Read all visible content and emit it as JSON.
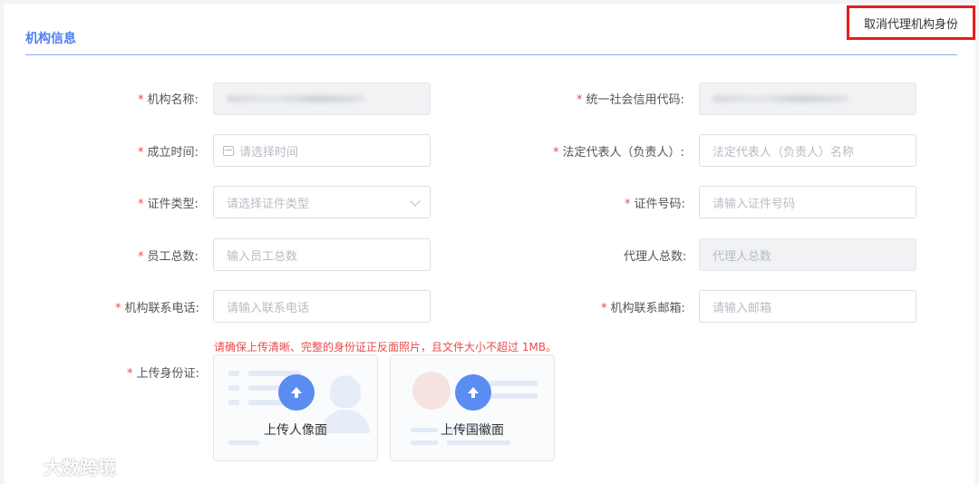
{
  "section": {
    "title": "机构信息"
  },
  "cancel_proxy_label": "取消代理机构身份",
  "fields": {
    "org_name": {
      "label": "机构名称:",
      "required": true
    },
    "credit_code": {
      "label": "统一社会信用代码:",
      "required": true
    },
    "founded": {
      "label": "成立时间:",
      "required": true,
      "placeholder": "请选择时间"
    },
    "legal_rep": {
      "label": "法定代表人（负责人）:",
      "required": true,
      "placeholder": "法定代表人（负责人）名称"
    },
    "id_type": {
      "label": "证件类型:",
      "required": true,
      "placeholder": "请选择证件类型"
    },
    "id_number": {
      "label": "证件号码:",
      "required": true,
      "placeholder": "请输入证件号码"
    },
    "staff_total": {
      "label": "员工总数:",
      "required": true,
      "placeholder": "输入员工总数"
    },
    "agent_total": {
      "label": "代理人总数:",
      "required": false,
      "placeholder": "代理人总数"
    },
    "org_phone": {
      "label": "机构联系电话:",
      "required": true,
      "placeholder": "请输入联系电话"
    },
    "org_email": {
      "label": "机构联系邮箱:",
      "required": true,
      "placeholder": "请输入邮箱"
    }
  },
  "upload": {
    "label": "上传身份证:",
    "warning": "请确保上传清晰、完整的身份证正反面照片，且文件大小不超过 1MB。",
    "front_label": "上传人像面",
    "back_label": "上传国徽面"
  },
  "watermark": "大数跨境",
  "colors": {
    "accent": "#4f7ef0",
    "required": "#e84c4c",
    "highlight": "#e81c1c"
  }
}
